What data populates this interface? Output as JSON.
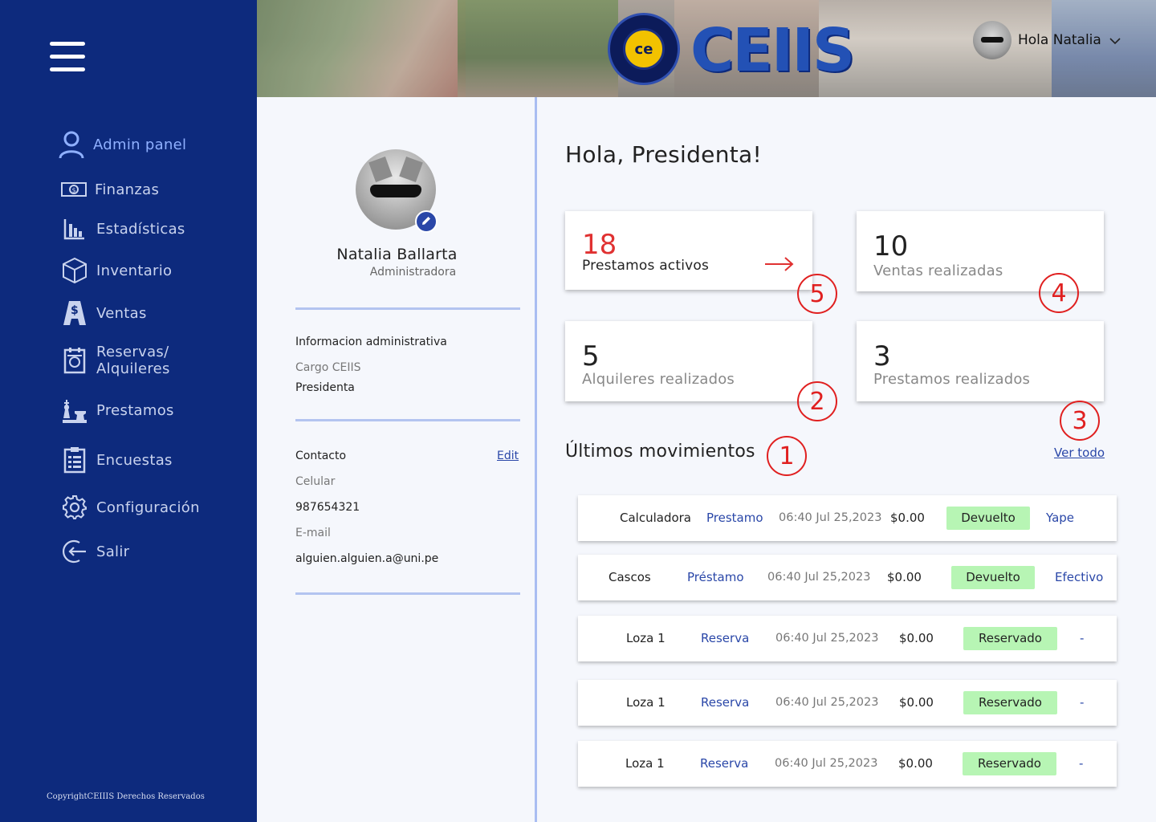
{
  "sidebar": {
    "items": [
      {
        "label": "Admin panel",
        "icon": "user-icon",
        "active": true
      },
      {
        "label": "Finanzas",
        "icon": "money-icon"
      },
      {
        "label": "Estadísticas",
        "icon": "bar-chart-icon"
      },
      {
        "label": "Inventario",
        "icon": "box-icon"
      },
      {
        "label": "Ventas",
        "icon": "sales-icon"
      },
      {
        "label": "Reservas/\nAlquileres",
        "label_line1": "Reservas/",
        "label_line2": "Alquileres",
        "icon": "calendar-icon"
      },
      {
        "label": "Prestamos",
        "icon": "chess-icon"
      },
      {
        "label": "Encuestas",
        "icon": "clipboard-icon"
      },
      {
        "label": "Configuración",
        "icon": "gear-icon"
      },
      {
        "label": "Salir",
        "icon": "logout-icon"
      }
    ],
    "copyright": "CopyrightCEIIIS Derechos Reservados"
  },
  "header": {
    "logo_badge": "ce",
    "logo_text": "CEIIS",
    "greeting": "Hola Natalia"
  },
  "profile": {
    "name": "Natalia Ballarta",
    "role": "Administradora",
    "admin_section_title": "Informacion administrativa",
    "cargo_label": "Cargo CEIIS",
    "cargo_value": "Presidenta",
    "contact_title": "Contacto",
    "edit_label": "Edit",
    "phone_label": "Celular",
    "phone_value": "987654321",
    "email_label": "E-mail",
    "email_value": "alguien.alguien.a@uni.pe"
  },
  "main": {
    "greeting": "Hola, Presidenta!",
    "cards": [
      {
        "value": "18",
        "caption": "Prestamos activos",
        "marker": "5"
      },
      {
        "value": "10",
        "caption": "Ventas realizadas",
        "marker": "4"
      },
      {
        "value": "5",
        "caption": "Alquileres realizados",
        "marker": "2"
      },
      {
        "value": "3",
        "caption": "Prestamos realizados",
        "marker": "3"
      }
    ],
    "movements_title": "Últimos movimientos",
    "movements_marker": "1",
    "see_all": "Ver todo",
    "movements": [
      {
        "item": "Calculadora",
        "type": "Prestamo",
        "date": "06:40 Jul 25,2023",
        "amount": "$0.00",
        "status": "Devuelto",
        "payment": "Yape"
      },
      {
        "item": "Cascos",
        "type": "Préstamo",
        "date": "06:40 Jul 25,2023",
        "amount": "$0.00",
        "status": "Devuelto",
        "payment": "Efectivo"
      },
      {
        "item": "Loza 1",
        "type": "Reserva",
        "date": "06:40 Jul 25,2023",
        "amount": "$0.00",
        "status": "Reservado",
        "payment": "-"
      },
      {
        "item": "Loza 1",
        "type": "Reserva",
        "date": "06:40 Jul 25,2023",
        "amount": "$0.00",
        "status": "Reservado",
        "payment": "-"
      },
      {
        "item": "Loza 1",
        "type": "Reserva",
        "date": "06:40 Jul 25,2023",
        "amount": "$0.00",
        "status": "Reservado",
        "payment": "-"
      }
    ]
  },
  "colors": {
    "sidebar_bg": "#0d2a7d",
    "accent": "#2a47a8",
    "active_nav": "#8fb0ff",
    "highlight_red": "#e03131",
    "status_green": "#b7f5b4"
  }
}
